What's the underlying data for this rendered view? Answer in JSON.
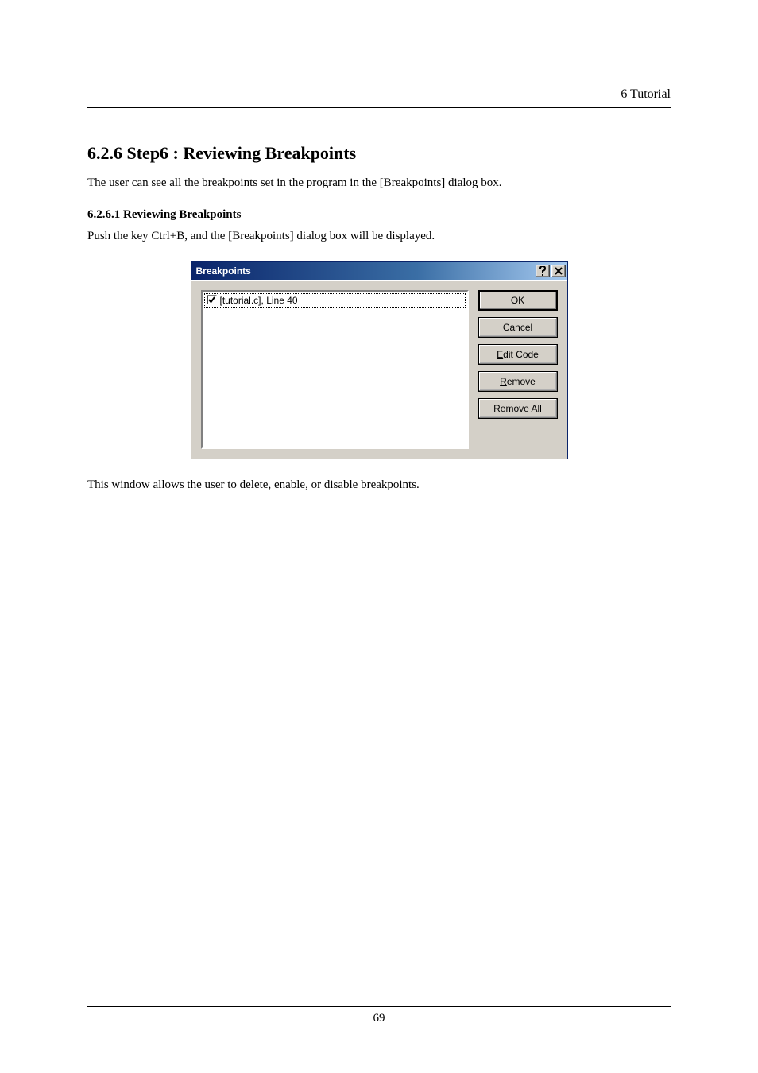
{
  "header_right": "6 Tutorial",
  "section_title": "6.2.6 Step6 : Reviewing Breakpoints",
  "para1": "The user can see all the breakpoints set in the program in the [Breakpoints] dialog box.",
  "subsection_title": "6.2.6.1 Reviewing Breakpoints",
  "para2": "Push the key Ctrl+B, and the [Breakpoints] dialog box will be displayed.",
  "dialog": {
    "title": "Breakpoints",
    "help_icon_name": "help-icon",
    "close_icon_name": "close-icon",
    "list_item_label": "[tutorial.c], Line 40",
    "buttons": {
      "ok": "OK",
      "cancel": "Cancel",
      "edit_code_pre": "",
      "edit_code_mnemonic": "E",
      "edit_code_post": "dit Code",
      "remove_pre": "",
      "remove_mnemonic": "R",
      "remove_post": "emove",
      "remove_all_pre": "Remove ",
      "remove_all_mnemonic": "A",
      "remove_all_post": "ll"
    }
  },
  "para3": "This window allows the user to delete, enable, or disable breakpoints.",
  "page_number": "69"
}
